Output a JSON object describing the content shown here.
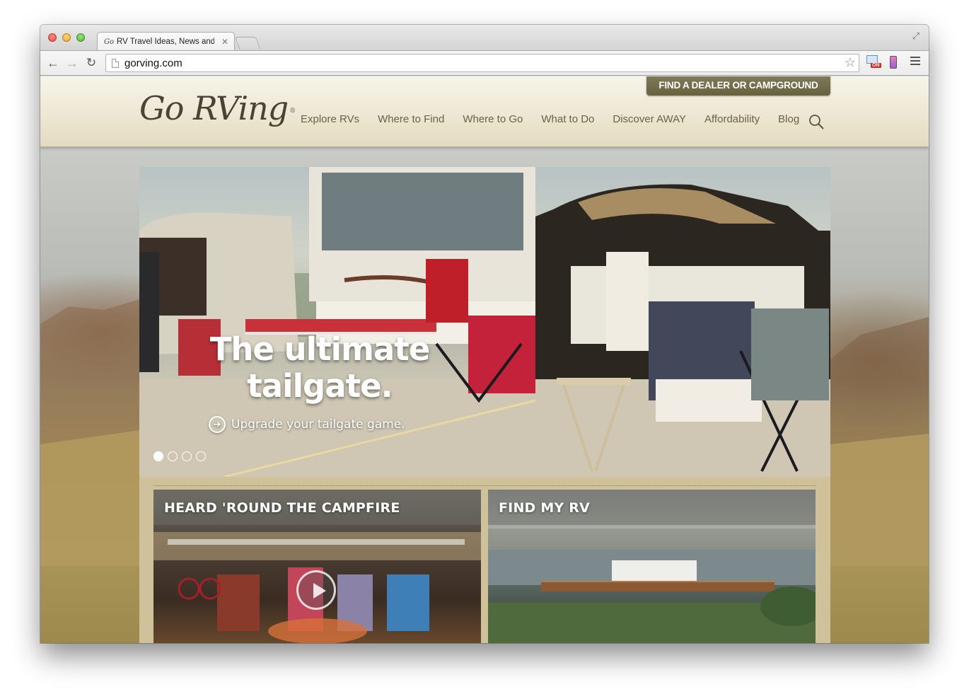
{
  "browser": {
    "tab_title": "RV Travel Ideas, News and",
    "tab_favicon": "Go",
    "url": "gorving.com",
    "ext_badge": "ON"
  },
  "site": {
    "logo": "Go RVing",
    "logo_mark": "®",
    "dealer_button": "FIND A DEALER OR CAMPGROUND",
    "nav": [
      "Explore RVs",
      "Where to Find",
      "Where to Go",
      "What to Do",
      "Discover AWAY",
      "Affordability",
      "Blog"
    ]
  },
  "hero": {
    "headline_line1": "The ultimate",
    "headline_line2": "tailgate.",
    "cta": "Upgrade your tailgate game.",
    "slide_count": 4,
    "active_slide": 1
  },
  "cards": [
    {
      "title": "HEARD 'ROUND THE CAMPFIRE",
      "has_video": true
    },
    {
      "title": "FIND MY RV",
      "has_video": false
    }
  ],
  "colors": {
    "accent_olive": "#6e6a48",
    "nav_text": "#6b6048",
    "panel_tan": "#cfc29a"
  }
}
